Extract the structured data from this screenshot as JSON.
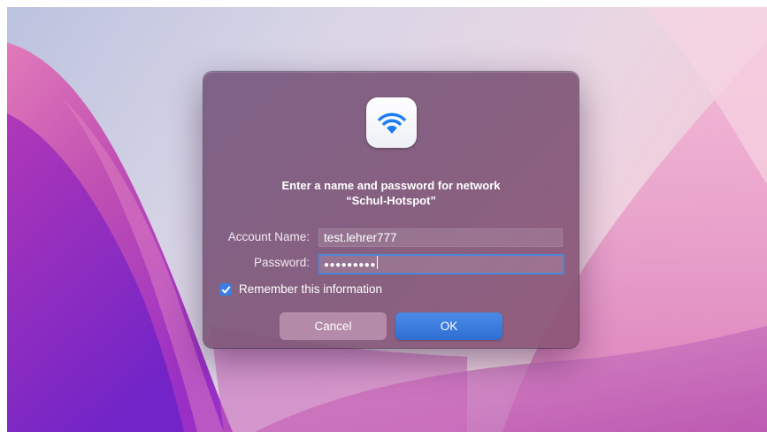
{
  "dialog": {
    "icon": "wifi-icon",
    "title_line1": "Enter a name and password for network",
    "title_line2": "“Schul-Hotspot”",
    "account_label": "Account Name:",
    "account_value": "test.lehrer777",
    "password_label": "Password:",
    "password_masked": "●●●●●●●●●",
    "remember_label": "Remember this information",
    "remember_checked": true,
    "cancel_label": "Cancel",
    "ok_label": "OK"
  },
  "colors": {
    "accent": "#3b7de0",
    "wallpaper_pink": "#e0a6cf",
    "wallpaper_purple": "#b03bc8"
  }
}
